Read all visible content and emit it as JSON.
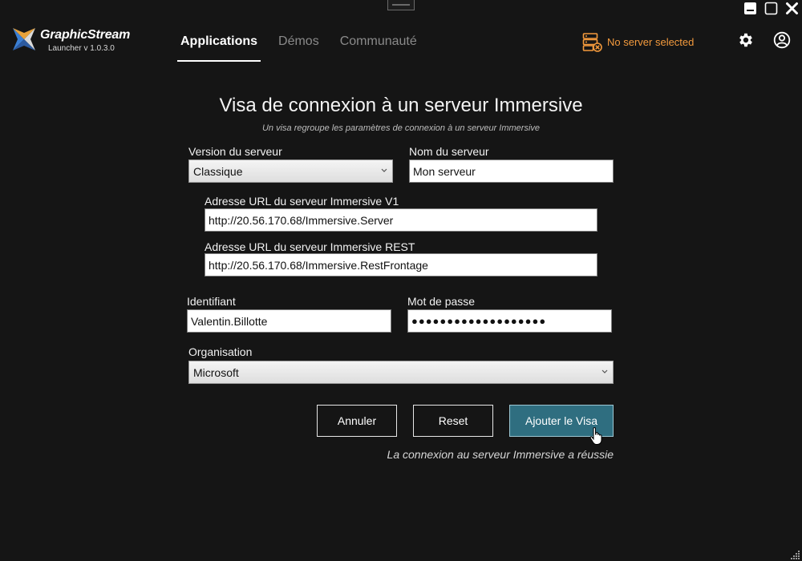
{
  "window": {
    "controls": [
      "minimize-icon",
      "maximize-icon",
      "close-icon"
    ]
  },
  "brand": {
    "name": "GraphicStream",
    "version": "Launcher v 1.0.3.0"
  },
  "nav": {
    "tabs": [
      {
        "label": "Applications",
        "active": true
      },
      {
        "label": "Démos",
        "active": false
      },
      {
        "label": "Communauté",
        "active": false
      }
    ]
  },
  "server_status": {
    "text": "No server selected",
    "color": "#f39a3d"
  },
  "form": {
    "title": "Visa de connexion à un serveur Immersive",
    "subtitle": "Un visa regroupe les paramètres de connexion à un serveur Immersive",
    "server_version": {
      "label": "Version du serveur",
      "value": "Classique"
    },
    "server_name": {
      "label": "Nom du serveur",
      "value": "Mon serveur"
    },
    "url_v1": {
      "label": "Adresse URL du serveur Immersive V1",
      "value": "http://20.56.170.68/Immersive.Server"
    },
    "url_rest": {
      "label": "Adresse URL du serveur Immersive REST",
      "value": "http://20.56.170.68/Immersive.RestFrontage"
    },
    "username": {
      "label": "Identifiant",
      "value": "Valentin.Billotte"
    },
    "password": {
      "label": "Mot de passe",
      "value": "●●●●●●●●●●●●●●●●●●●"
    },
    "organisation": {
      "label": "Organisation",
      "value": "Microsoft"
    }
  },
  "buttons": {
    "cancel": "Annuler",
    "reset": "Reset",
    "add": "Ajouter le Visa"
  },
  "status_message": "La connexion au serveur Immersive a réussie",
  "colors": {
    "background": "#151515",
    "accent": "#2f6e80",
    "warning": "#f39a3d"
  }
}
